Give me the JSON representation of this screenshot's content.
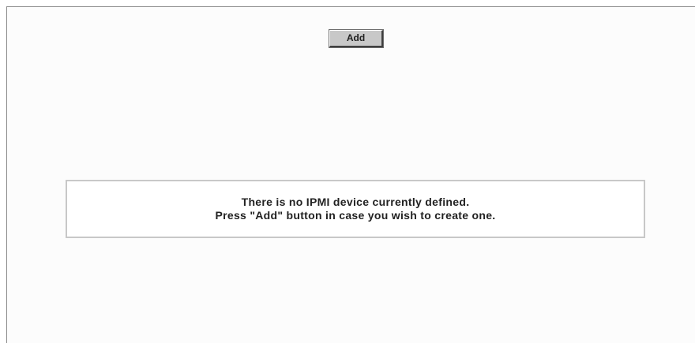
{
  "toolbar": {
    "add_label": "Add"
  },
  "message": {
    "line1": "There is no IPMI device currently defined.",
    "line2": "Press \"Add\" button in case you wish to create one."
  },
  "colors": {
    "background": "#fcfcfc",
    "button_face": "#c8c8c8",
    "message_border": "#c8c8c8",
    "text": "#222222"
  }
}
